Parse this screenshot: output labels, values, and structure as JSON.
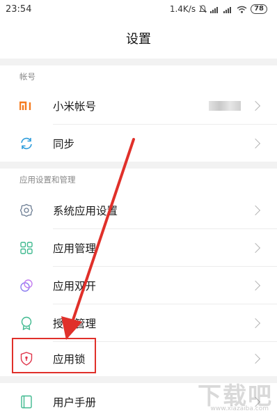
{
  "status_bar": {
    "time": "23:54",
    "network_speed": "1.4K/s",
    "battery": "78"
  },
  "header": {
    "title": "设置"
  },
  "sections": [
    {
      "title": "帐号",
      "items": [
        {
          "label": "小米帐号",
          "icon": "mi-logo-icon",
          "accent": "#f57c1f"
        },
        {
          "label": "同步",
          "icon": "sync-icon",
          "accent": "#2d9cdb"
        }
      ]
    },
    {
      "title": "应用设置和管理",
      "items": [
        {
          "label": "系统应用设置",
          "icon": "gear-icon",
          "accent": "#6c7d93"
        },
        {
          "label": "应用管理",
          "icon": "grid-icon",
          "accent": "#3fb98f"
        },
        {
          "label": "应用双开",
          "icon": "dual-app-icon",
          "accent": "#8b7cf0"
        },
        {
          "label": "授权管理",
          "icon": "badge-icon",
          "accent": "#3fb98f"
        },
        {
          "label": "应用锁",
          "icon": "shield-lock-icon",
          "accent": "#e0344a"
        }
      ]
    },
    {
      "title": "",
      "items": [
        {
          "label": "用户手册",
          "icon": "manual-icon",
          "accent": "#3fb98f"
        }
      ]
    }
  ],
  "annotation": {
    "arrow_color": "#e0302a"
  },
  "watermark": {
    "text": "下载吧",
    "url": "www.xiazaiba.com"
  }
}
